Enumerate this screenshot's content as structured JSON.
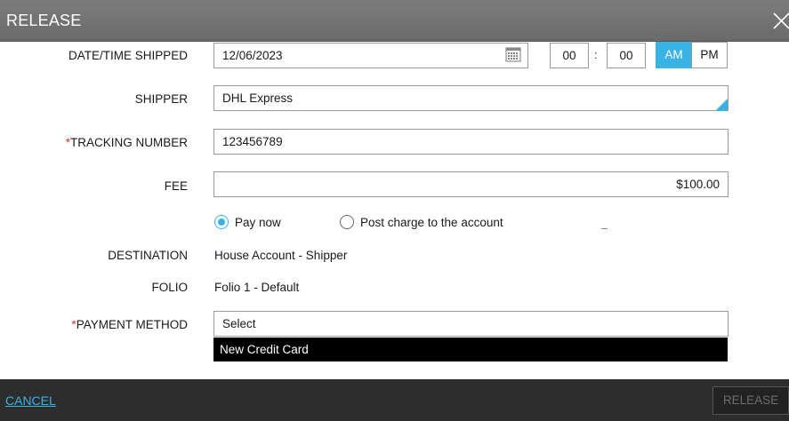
{
  "dialog": {
    "title": "RELEASE",
    "close_icon": "close-icon"
  },
  "form": {
    "date_time": {
      "label": "DATE/TIME SHIPPED",
      "date_value": "12/06/2023",
      "calendar_icon": "calendar-icon",
      "hour": "00",
      "separator": ":",
      "minute": "00",
      "am_label": "AM",
      "pm_label": "PM",
      "selected_period": "AM"
    },
    "shipper": {
      "label": "SHIPPER",
      "value": "DHL Express"
    },
    "tracking": {
      "required_mark": "*",
      "label": "TRACKING NUMBER",
      "value": "123456789"
    },
    "fee": {
      "label": "FEE",
      "value": "$100.00"
    },
    "payment_option": {
      "pay_now_label": "Pay now",
      "post_charge_label": "Post charge to the account",
      "selected": "Pay now"
    },
    "destination": {
      "label": "DESTINATION",
      "value": "House Account - Shipper"
    },
    "folio": {
      "label": "FOLIO",
      "value": "Folio 1 - Default"
    },
    "payment_method": {
      "required_mark": "*",
      "label": "PAYMENT METHOD",
      "value": "Select",
      "dropdown_options": [
        "New Credit Card"
      ]
    }
  },
  "footer": {
    "cancel_label": "CANCEL",
    "release_label": "RELEASE"
  },
  "colors": {
    "accent": "#39b3e3",
    "header_bg": "#727272",
    "footer_bg": "#2d2d2d",
    "required": "#dd3333"
  }
}
